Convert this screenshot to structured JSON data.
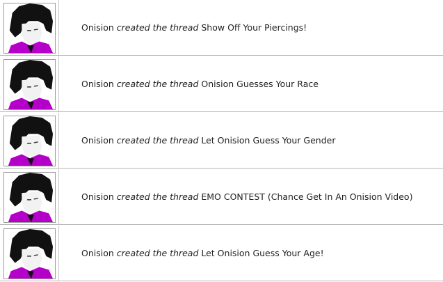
{
  "feed": {
    "items": [
      {
        "user": "Onision",
        "action": "created the thread",
        "thread": "Show Off Your Piercings!"
      },
      {
        "user": "Onision",
        "action": "created the thread",
        "thread": "Onision Guesses Your Race"
      },
      {
        "user": "Onision",
        "action": "created the thread",
        "thread": "Let Onision Guess Your Gender"
      },
      {
        "user": "Onision",
        "action": "created the thread",
        "thread": "EMO CONTEST (Chance Get In An Onision Video)"
      },
      {
        "user": "Onision",
        "action": "created the thread",
        "thread": "Let Onision Guess Your Age!"
      }
    ]
  },
  "colors": {
    "divider": "#b5b5b5",
    "text": "#222222",
    "avatar_accent": "#b400c8"
  },
  "icons": {
    "avatar": "user-avatar-portrait"
  }
}
